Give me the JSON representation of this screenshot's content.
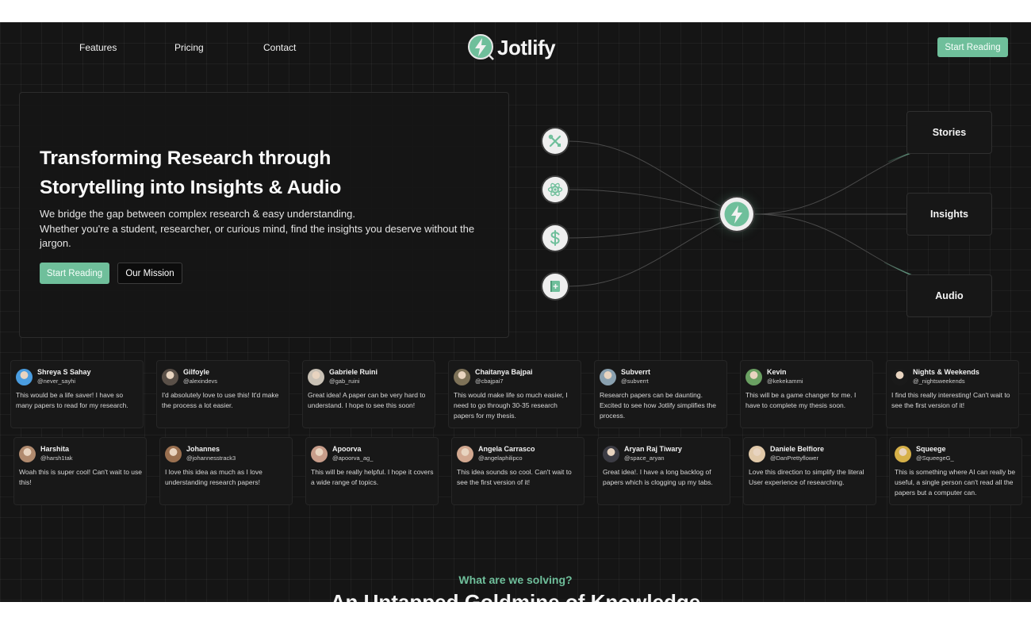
{
  "nav": {
    "links": [
      "Features",
      "Pricing",
      "Contact"
    ],
    "brand": "Jotlify",
    "cta": "Start Reading"
  },
  "hero": {
    "title_line1": "Transforming Research through",
    "title_line2": "Storytelling into Insights & Audio",
    "desc_line1": "We bridge the gap between complex research & easy understanding.",
    "desc_line2": "Whether you're a student, researcher, or curious mind, find the insights you deserve without the",
    "desc_line3": "jargon.",
    "primary_button": "Start Reading",
    "secondary_button": "Our Mission"
  },
  "flow": {
    "sources": [
      "tools-icon",
      "atom-icon",
      "dollar-icon",
      "notebook-icon"
    ],
    "hub": "jotlify-bolt-icon",
    "outputs": [
      "Stories",
      "Insights",
      "Audio"
    ]
  },
  "testimonials": {
    "row1": [
      {
        "name": "Shreya S Sahay",
        "handle": "@never_sayhi",
        "text": "This would be a life saver! I have so many papers to read for my research.",
        "avatar_color": "#4a9de0"
      },
      {
        "name": "Gilfoyle",
        "handle": "@alexindevs",
        "text": "I'd absolutely love to use this! It'd make the process a lot easier.",
        "avatar_color": "#5a5048"
      },
      {
        "name": "Gabriele Ruini",
        "handle": "@gab_ruini",
        "text": "Great idea! A paper can be very hard to understand. I hope to see this soon!",
        "avatar_color": "#c9c1b5"
      },
      {
        "name": "Chaitanya Bajpai",
        "handle": "@cbajpai7",
        "text": "This would make life so much easier, I need to go through 30-35 research papers for my thesis.",
        "avatar_color": "#7e7258"
      },
      {
        "name": "Subverrt",
        "handle": "@subverrt",
        "text": "Research papers can be daunting. Excited to see how Jotlify simplifies the process.",
        "avatar_color": "#8aa1b0"
      },
      {
        "name": "Kevin",
        "handle": "@kekekammi",
        "text": "This will be a game changer for me. I have to complete my thesis soon.",
        "avatar_color": "#6aa062"
      },
      {
        "name": "Nights & Weekends",
        "handle": "@_nightsweekends",
        "text": "I find this really interesting! Can't wait to see the first version of it!",
        "avatar_color": "#1a1a1a"
      }
    ],
    "row2": [
      {
        "name": "Harshita",
        "handle": "@harsh1tak",
        "text": "Woah this is super cool! Can't wait to use this!",
        "avatar_color": "#b08a6e"
      },
      {
        "name": "Johannes",
        "handle": "@johannesstrack3",
        "text": "I love this idea as much as I love understanding research papers!",
        "avatar_color": "#9a7050"
      },
      {
        "name": "Apoorva",
        "handle": "@apoorva_ag_",
        "text": "This will be really helpful. I hope it covers a wide range of topics.",
        "avatar_color": "#c89d8a"
      },
      {
        "name": "Angela Carrasco",
        "handle": "@angelaphilipco",
        "text": "This idea sounds so cool. Can't wait to see the first version of it!",
        "avatar_color": "#d2a890"
      },
      {
        "name": "Aryan Raj Tiwary",
        "handle": "@space_aryan",
        "text": "Great idea!. I have a long backlog of papers which is clogging up my tabs.",
        "avatar_color": "#3c3c44"
      },
      {
        "name": "Daniele Belfiore",
        "handle": "@DanPrettyflower",
        "text": "Love this direction to simplify the literal User experience of researching.",
        "avatar_color": "#e0c8a8"
      },
      {
        "name": "Squeege",
        "handle": "@SqueegeG_",
        "text": "This is something where AI can really be useful, a single person can't read all the papers but a computer can.",
        "avatar_color": "#d6b048"
      }
    ]
  },
  "section": {
    "eyebrow": "What are we solving?",
    "heading": "An Untapped Goldmine of Knowledge"
  },
  "colors": {
    "accent": "#6fbf9b",
    "background": "#151515"
  }
}
